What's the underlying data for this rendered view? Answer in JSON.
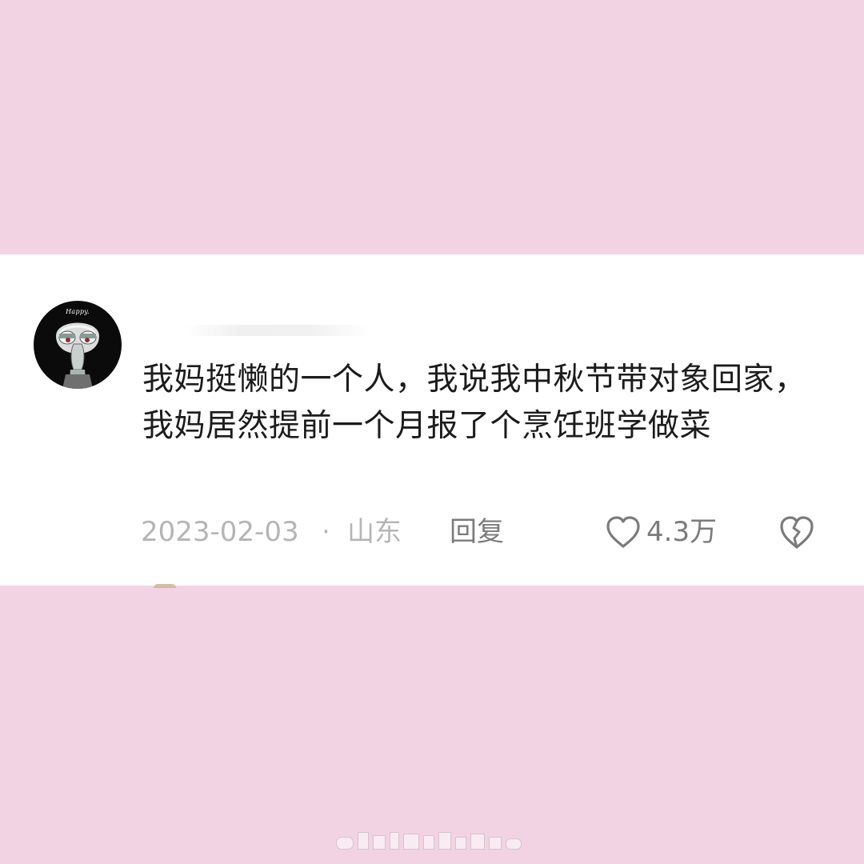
{
  "comment": {
    "avatar_caption": "Happy.",
    "text": "我妈挺懒的一个人，我说我中秋节带对象回家，我妈居然提前一个月报了个烹饪班学做菜",
    "date": "2023-02-03",
    "separator": "·",
    "location": "山东",
    "reply_label": "回复",
    "like_count": "4.3万",
    "icons": {
      "like": "heart-outline-icon",
      "dislike": "broken-heart-icon"
    }
  },
  "colors": {
    "page_background": "#f2d3e3",
    "card_background": "#ffffff",
    "text_primary": "#1c1c1c",
    "text_muted": "#b5b5b5",
    "text_action": "#7b7b7b"
  }
}
